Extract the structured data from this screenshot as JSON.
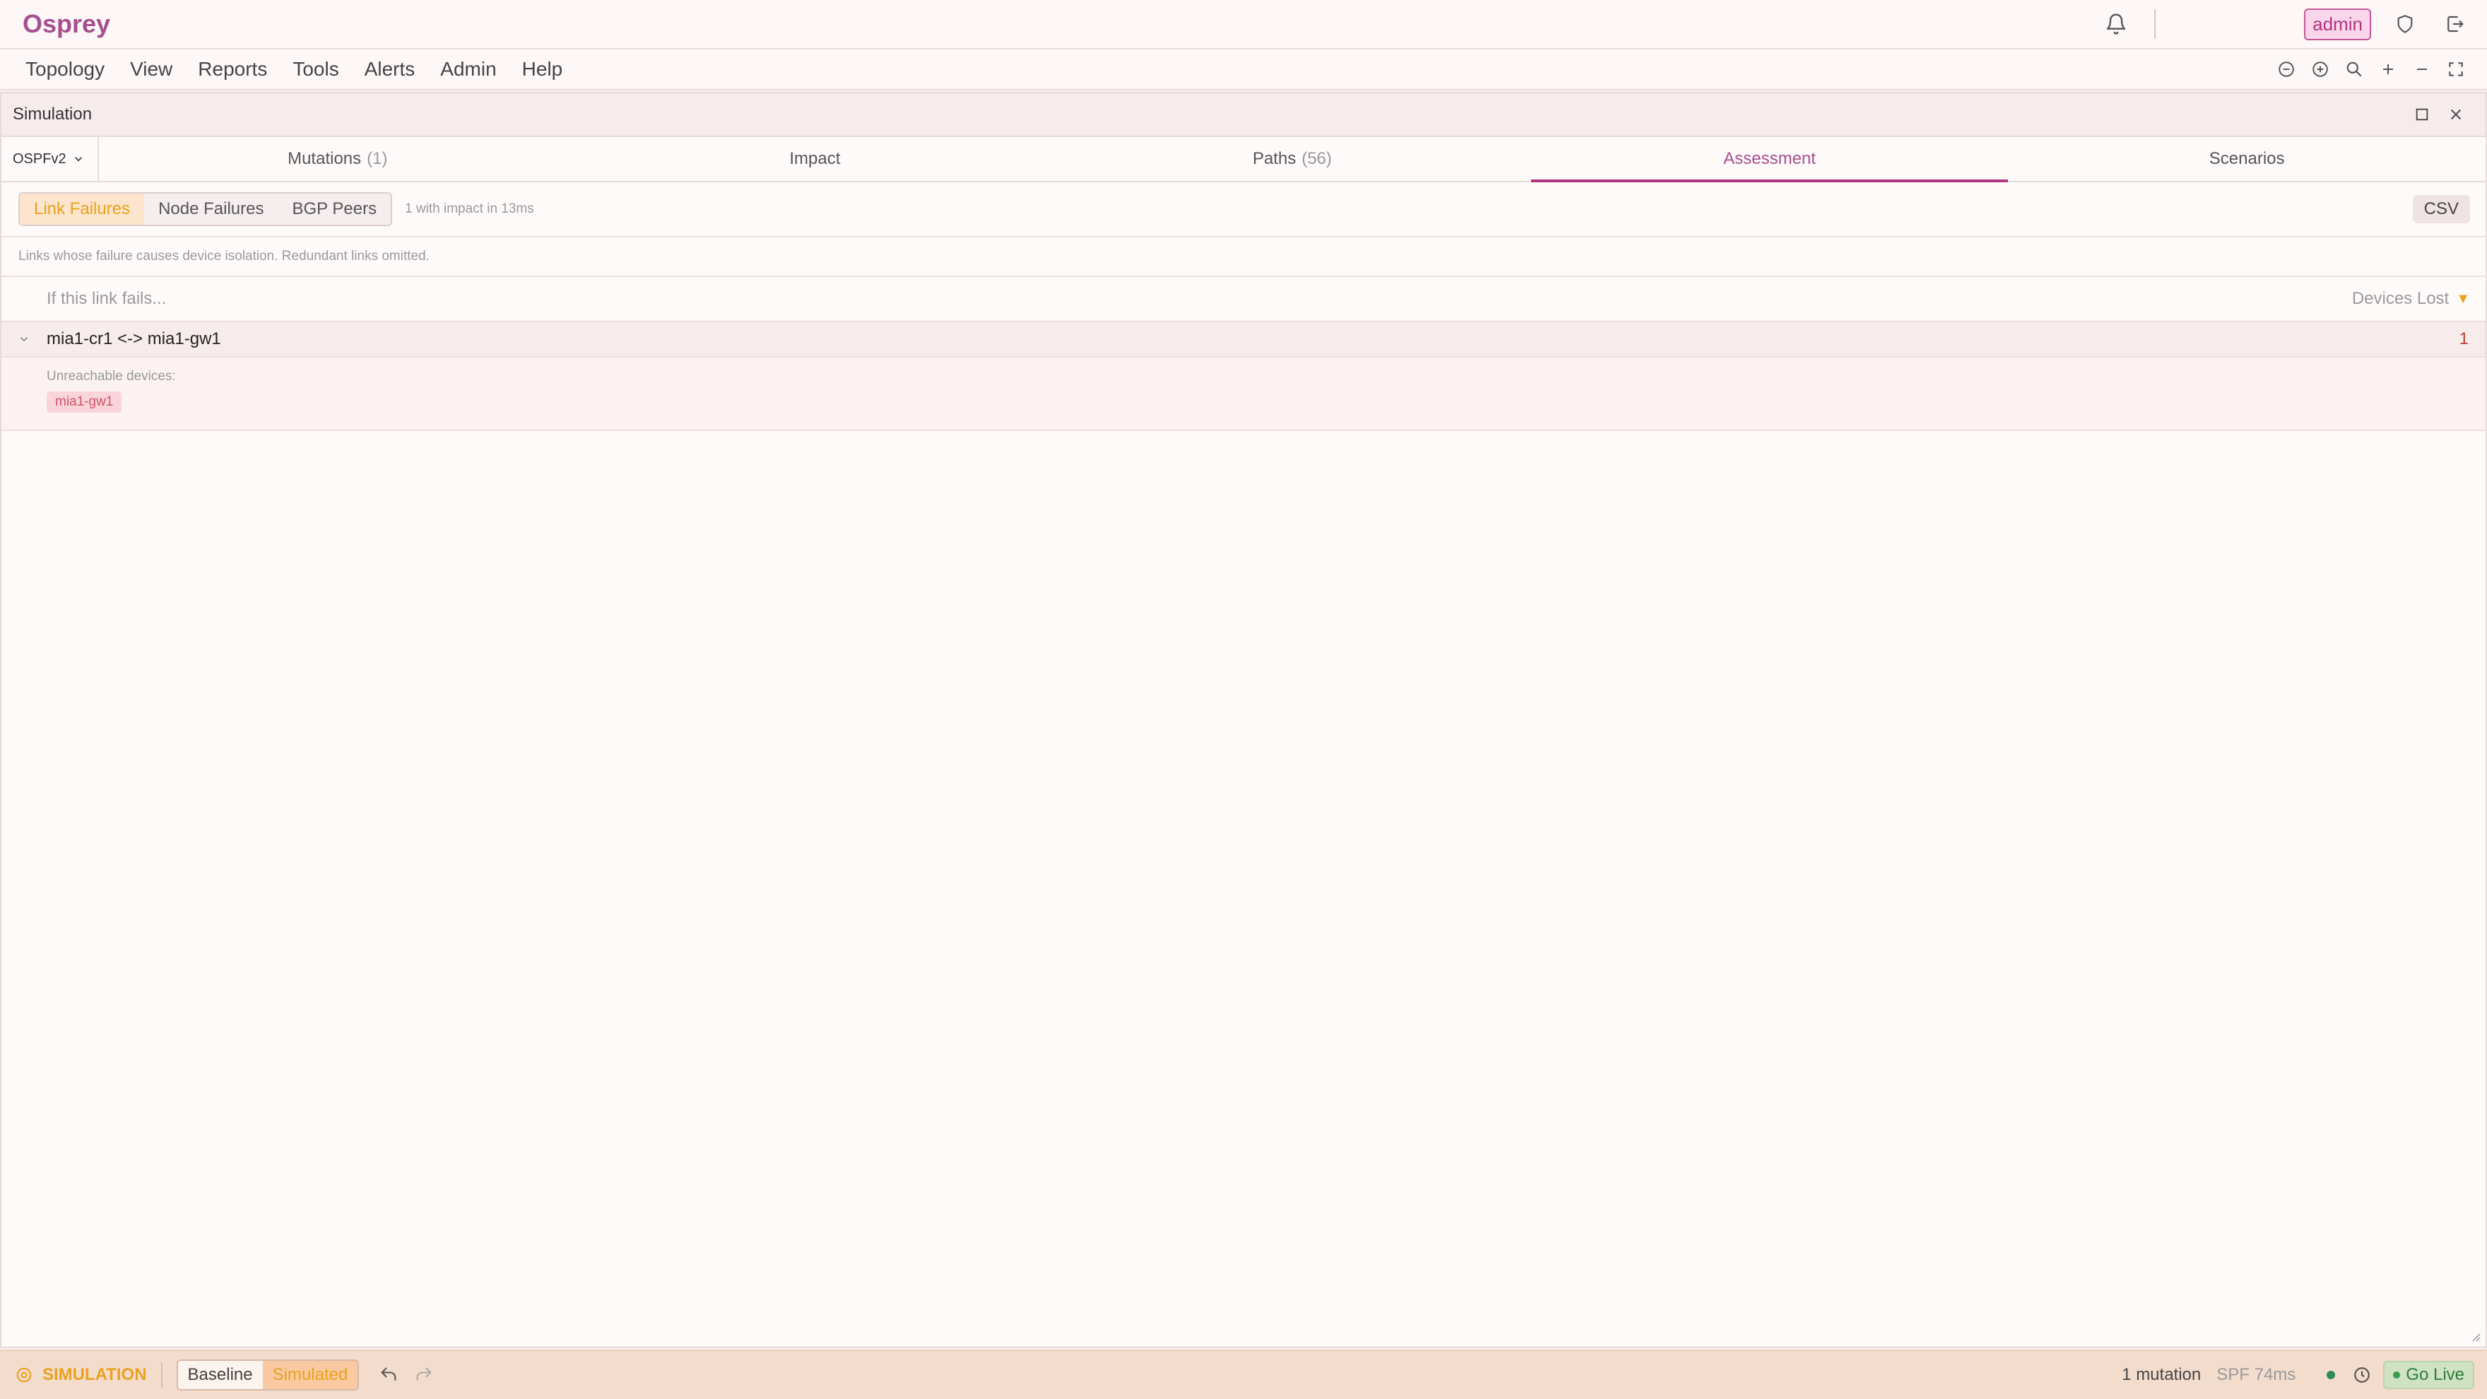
{
  "header": {
    "brand": "Osprey",
    "user_badge": "admin",
    "icons": [
      "bell-icon",
      "shield-icon",
      "logout-icon"
    ]
  },
  "menu": {
    "items": [
      {
        "label": "Topology"
      },
      {
        "label": "View"
      },
      {
        "label": "Reports"
      },
      {
        "label": "Tools"
      },
      {
        "label": "Alerts"
      },
      {
        "label": "Admin"
      },
      {
        "label": "Help"
      }
    ],
    "tools": [
      "zoom-out-circle-icon",
      "zoom-in-circle-icon",
      "search-icon",
      "plus-icon",
      "minus-icon",
      "fullscreen-icon"
    ]
  },
  "panel": {
    "title": "Simulation",
    "protocol": "OSPFv2",
    "tabs": [
      {
        "label": "Mutations",
        "count": "(1)",
        "active": false
      },
      {
        "label": "Impact",
        "count": "",
        "active": false
      },
      {
        "label": "Paths",
        "count": "(56)",
        "active": false
      },
      {
        "label": "Assessment",
        "count": "",
        "active": true
      },
      {
        "label": "Scenarios",
        "count": "",
        "active": false
      }
    ],
    "filters": {
      "segments": [
        {
          "label": "Link Failures",
          "active": true
        },
        {
          "label": "Node Failures",
          "active": false
        },
        {
          "label": "BGP Peers",
          "active": false
        }
      ],
      "meta": "1 with impact in 13ms",
      "export_label": "CSV"
    },
    "description": "Links whose failure causes device isolation. Redundant links omitted.",
    "columns": {
      "left": "If this link fails...",
      "right": "Devices Lost",
      "sort_indicator": "▼"
    },
    "rows": [
      {
        "link": "mia1-cr1 <-> mia1-gw1",
        "devices_lost": "1",
        "detail_label": "Unreachable devices:",
        "devices": [
          "mia1-gw1"
        ]
      }
    ]
  },
  "footer": {
    "mode_label": "SIMULATION",
    "modes": [
      {
        "label": "Baseline",
        "active": false
      },
      {
        "label": "Simulated",
        "active": true
      }
    ],
    "mutations": "1 mutation",
    "spf": "SPF 74ms",
    "go_live": "Go Live"
  },
  "colors": {
    "brand": "#a64f91",
    "accent": "#e9a21e",
    "danger": "#c0392b",
    "live": "#2e7d3e"
  }
}
